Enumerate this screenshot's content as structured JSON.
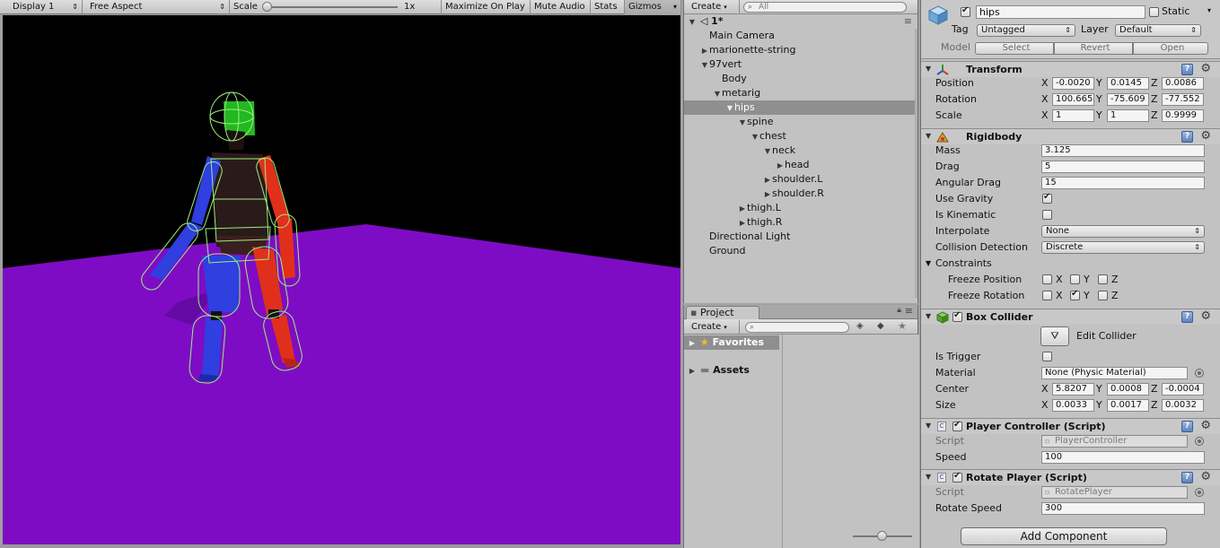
{
  "game_toolbar": {
    "display": "Display 1",
    "aspect": "Free Aspect",
    "scale_label": "Scale",
    "scale_value": "1x",
    "maximize": "Maximize On Play",
    "mute": "Mute Audio",
    "stats": "Stats",
    "gizmos": "Gizmos"
  },
  "hierarchy": {
    "create": "Create",
    "search_placeholder": "All",
    "scene": "1*",
    "items": [
      {
        "label": "Main Camera",
        "depth": 0,
        "arrow": "",
        "selected": false
      },
      {
        "label": "marionette-string",
        "depth": 0,
        "arrow": "▶",
        "selected": false
      },
      {
        "label": "97vert",
        "depth": 0,
        "arrow": "▼",
        "selected": false
      },
      {
        "label": "Body",
        "depth": 1,
        "arrow": "",
        "selected": false
      },
      {
        "label": "metarig",
        "depth": 1,
        "arrow": "▼",
        "selected": false
      },
      {
        "label": "hips",
        "depth": 2,
        "arrow": "▼",
        "selected": true
      },
      {
        "label": "spine",
        "depth": 3,
        "arrow": "▼",
        "selected": false
      },
      {
        "label": "chest",
        "depth": 4,
        "arrow": "▼",
        "selected": false
      },
      {
        "label": "neck",
        "depth": 5,
        "arrow": "▼",
        "selected": false
      },
      {
        "label": "head",
        "depth": 6,
        "arrow": "▶",
        "selected": false
      },
      {
        "label": "shoulder.L",
        "depth": 5,
        "arrow": "▶",
        "selected": false
      },
      {
        "label": "shoulder.R",
        "depth": 5,
        "arrow": "▶",
        "selected": false
      },
      {
        "label": "thigh.L",
        "depth": 3,
        "arrow": "▶",
        "selected": false
      },
      {
        "label": "thigh.R",
        "depth": 3,
        "arrow": "▶",
        "selected": false
      },
      {
        "label": "Directional Light",
        "depth": 0,
        "arrow": "",
        "selected": false
      },
      {
        "label": "Ground",
        "depth": 0,
        "arrow": "",
        "selected": false
      }
    ]
  },
  "project": {
    "tab": "Project",
    "create": "Create",
    "favorites": "Favorites",
    "assets": "Assets"
  },
  "inspector": {
    "object_name": "hips",
    "static_label": "Static",
    "tag_label": "Tag",
    "tag_value": "Untagged",
    "layer_label": "Layer",
    "layer_value": "Default",
    "model_label": "Model",
    "model_select": "Select",
    "model_revert": "Revert",
    "model_open": "Open",
    "transform": {
      "title": "Transform",
      "position_label": "Position",
      "position": {
        "x": "-0.0020",
        "y": "0.0145",
        "z": "0.0086"
      },
      "rotation_label": "Rotation",
      "rotation": {
        "x": "100.665",
        "y": "-75.609",
        "z": "-77.552"
      },
      "scale_label": "Scale",
      "scale": {
        "x": "1",
        "y": "1",
        "z": "0.9999"
      }
    },
    "rigidbody": {
      "title": "Rigidbody",
      "mass_label": "Mass",
      "mass": "3.125",
      "drag_label": "Drag",
      "drag": "5",
      "angular_drag_label": "Angular Drag",
      "angular_drag": "15",
      "use_gravity_label": "Use Gravity",
      "is_kinematic_label": "Is Kinematic",
      "interpolate_label": "Interpolate",
      "interpolate": "None",
      "collision_label": "Collision Detection",
      "collision": "Discrete",
      "constraints_label": "Constraints",
      "freeze_pos_label": "Freeze Position",
      "freeze_rot_label": "Freeze Rotation",
      "x": "X",
      "y": "Y",
      "z": "Z"
    },
    "box_collider": {
      "title": "Box Collider",
      "edit_label": "Edit Collider",
      "is_trigger_label": "Is Trigger",
      "material_label": "Material",
      "material": "None (Physic Material)",
      "center_label": "Center",
      "center": {
        "x": "5.8207",
        "y": "0.0008",
        "z": "-0.0004"
      },
      "size_label": "Size",
      "size": {
        "x": "0.0033",
        "y": "0.0017",
        "z": "0.0032"
      }
    },
    "player_controller": {
      "title": "Player Controller (Script)",
      "script_label": "Script",
      "script": "PlayerController",
      "speed_label": "Speed",
      "speed": "100"
    },
    "rotate_player": {
      "title": "Rotate Player (Script)",
      "script_label": "Script",
      "script": "RotatePlayer",
      "rotate_speed_label": "Rotate Speed",
      "rotate_speed": "300"
    },
    "add_component": "Add Component"
  },
  "colors": {
    "sky": "#000000",
    "ground": "#7e0cc4",
    "head": "#22b822",
    "left_limb": "#2f3fe0",
    "right_limb": "#e0301c",
    "wire": "#9cf07c"
  }
}
